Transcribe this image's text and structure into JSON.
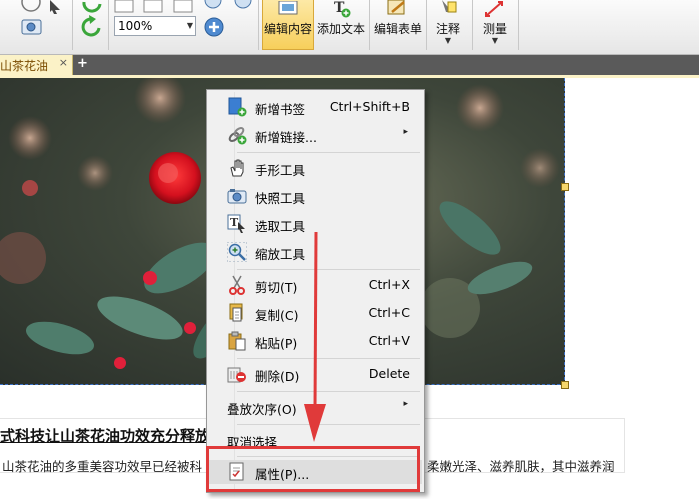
{
  "ribbon": {
    "zoom_value": "100%",
    "buttons": [
      {
        "id": "edit_content",
        "label": "编辑内容"
      },
      {
        "id": "add_text",
        "label": "添加文本"
      },
      {
        "id": "edit_form",
        "label": "编辑表单"
      },
      {
        "id": "annotate",
        "label": "注释"
      },
      {
        "id": "measure",
        "label": "测量"
      }
    ]
  },
  "tabs": {
    "doc_tab_label": "山茶花油",
    "close_glyph": "×",
    "new_tab_glyph": "+"
  },
  "document": {
    "headline": "式科技让山茶花油功效充分释放",
    "body_left": "山茶花油的多重美容功效早已经被科",
    "body_right": "柔嫩光泽、滋养肌肤，其中滋养润"
  },
  "context_menu": {
    "items": [
      {
        "id": "new_bookmark",
        "label": "新增书签",
        "shortcut": "Ctrl+Shift+B",
        "icon": "bookmark-add-icon"
      },
      {
        "id": "new_link",
        "label": "新增链接...",
        "submenu": "▸",
        "icon": "link-add-icon"
      },
      {
        "id": "hand_tool",
        "label": "手形工具",
        "icon": "hand-icon"
      },
      {
        "id": "snapshot_tool",
        "label": "快照工具",
        "icon": "camera-icon"
      },
      {
        "id": "select_tool",
        "label": "选取工具",
        "icon": "select-text-icon"
      },
      {
        "id": "zoom_tool",
        "label": "缩放工具",
        "icon": "zoom-icon"
      },
      {
        "id": "cut",
        "label": "剪切(T)",
        "shortcut": "Ctrl+X",
        "icon": "scissors-icon"
      },
      {
        "id": "copy",
        "label": "复制(C)",
        "shortcut": "Ctrl+C",
        "icon": "copy-icon"
      },
      {
        "id": "paste",
        "label": "粘贴(P)",
        "shortcut": "Ctrl+V",
        "icon": "paste-icon"
      },
      {
        "id": "delete",
        "label": "删除(D)",
        "shortcut": "Delete",
        "icon": "delete-icon"
      },
      {
        "id": "stack_order",
        "label": "叠放次序(O)",
        "submenu": "▸"
      },
      {
        "id": "deselect",
        "label": "取消选择"
      },
      {
        "id": "properties",
        "label": "属性(P)...",
        "icon": "properties-icon"
      }
    ]
  },
  "colors": {
    "highlight_red": "#e03a3a",
    "tab_yellow": "#fbf2c7",
    "selection_blue": "#3a6fc7"
  }
}
